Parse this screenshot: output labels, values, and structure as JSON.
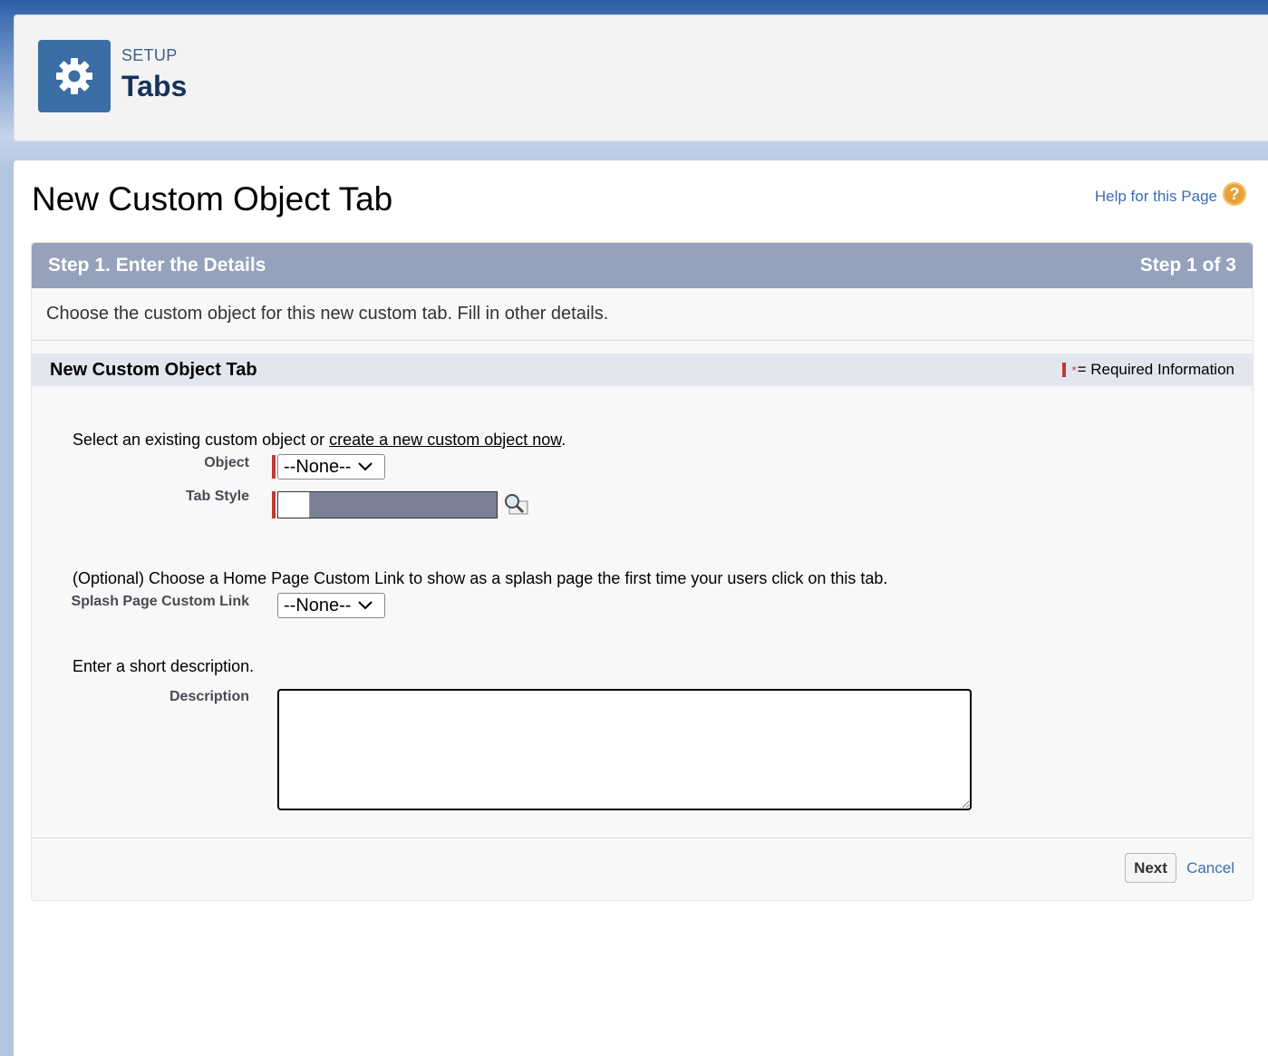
{
  "setup": {
    "eyebrow": "SETUP",
    "title": "Tabs"
  },
  "page": {
    "title": "New Custom Object Tab",
    "help_link": "Help for this Page",
    "help_icon": "?"
  },
  "step": {
    "title": "Step 1. Enter the Details",
    "counter": "Step 1 of 3",
    "description": "Choose the custom object for this new custom tab. Fill in other details."
  },
  "section": {
    "title": "New Custom Object Tab",
    "required_legend_star": "*",
    "required_legend": "= Required Information"
  },
  "form": {
    "object_instruction_prefix": "Select an existing custom object or ",
    "object_instruction_link": "create a new custom object now",
    "object_instruction_suffix": ".",
    "object_label": "Object",
    "object_value": "--None--",
    "tab_style_label": "Tab Style",
    "splash_instruction": "(Optional) Choose a Home Page Custom Link to show as a splash page the first time your users click on this tab.",
    "splash_label": "Splash Page Custom Link",
    "splash_value": "--None--",
    "description_instruction": "Enter a short description.",
    "description_label": "Description",
    "description_value": ""
  },
  "buttons": {
    "next": "Next",
    "cancel": "Cancel"
  },
  "colors": {
    "step_header": "#96a1bb",
    "section_header": "#e3e6ef",
    "required": "#c23934",
    "link": "#3e6db3",
    "setup_icon": "#3a6ea5",
    "tab_style_swatch": "#7a8096"
  },
  "icons": {
    "setup_icon": "gear-icon",
    "help_icon": "help-icon",
    "tab_style_lookup": "magnifier-icon",
    "select_chevron": "chevron-down-icon"
  }
}
